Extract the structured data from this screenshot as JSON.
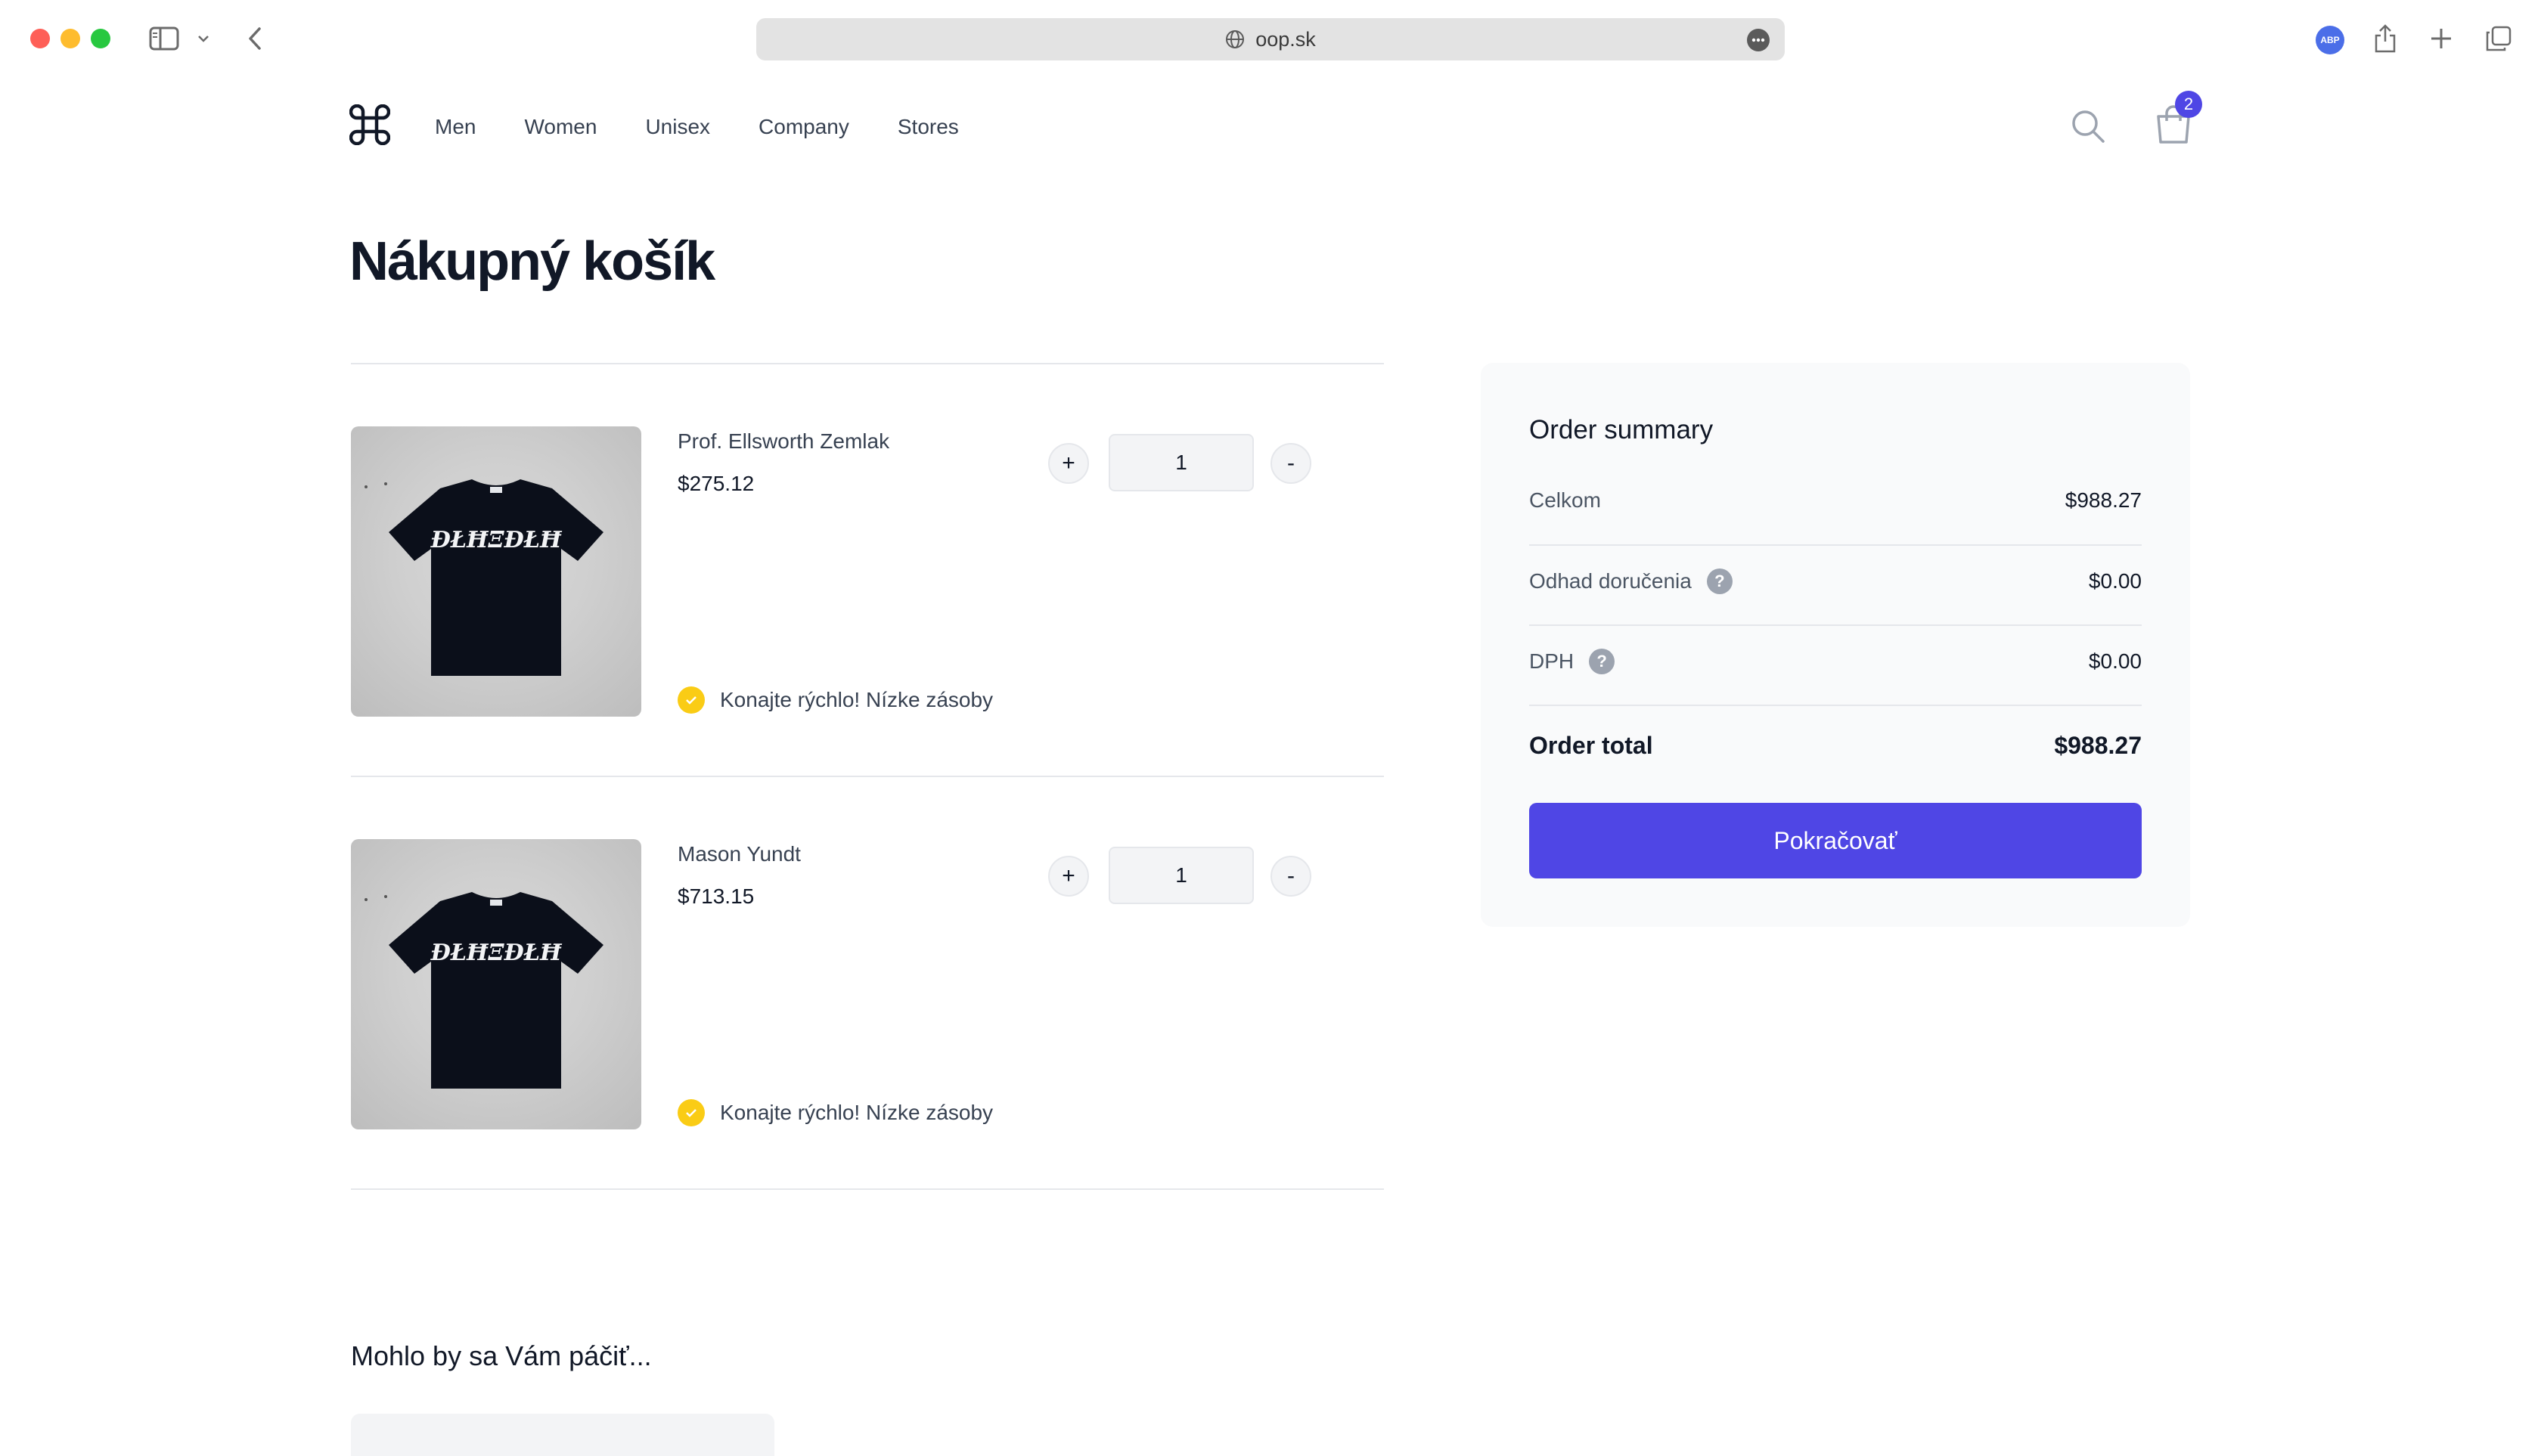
{
  "browser": {
    "url": "oop.sk",
    "abp_label": "ABP"
  },
  "nav": {
    "items": [
      "Men",
      "Women",
      "Unisex",
      "Company",
      "Stores"
    ],
    "cart_count": "2"
  },
  "page": {
    "title": "Nákupný košík"
  },
  "cart": {
    "items": [
      {
        "name": "Prof. Ellsworth Zemlak",
        "price": "$275.12",
        "quantity": "1",
        "stock_status": "Konajte rýchlo! Nízke zásoby"
      },
      {
        "name": "Mason Yundt",
        "price": "$713.15",
        "quantity": "1",
        "stock_status": "Konajte rýchlo! Nízke zásoby"
      }
    ],
    "plus_label": "+",
    "minus_label": "-"
  },
  "summary": {
    "title": "Order summary",
    "subtotal_label": "Celkom",
    "subtotal_value": "$988.27",
    "shipping_label": "Odhad doručenia",
    "shipping_value": "$0.00",
    "tax_label": "DPH",
    "tax_value": "$0.00",
    "total_label": "Order total",
    "total_value": "$988.27",
    "checkout_label": "Pokračovať",
    "help_glyph": "?"
  },
  "recommendations": {
    "title": "Mohlo by sa Vám páčiť..."
  },
  "colors": {
    "accent": "#4f46e5",
    "stock_warning": "#facc15"
  }
}
